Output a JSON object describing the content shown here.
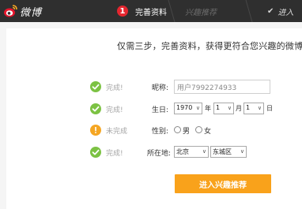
{
  "header": {
    "logo_text": "微博",
    "steps": [
      {
        "number": "1",
        "label": "完善资料"
      },
      {
        "label": "兴趣推荐"
      },
      {
        "label": "进入"
      }
    ]
  },
  "intro_text": "仅需三步，完善资料，获得更符合您兴趣的微博内",
  "form": {
    "nickname": {
      "status": "完成!",
      "label": "昵称:",
      "value": "用户7992274933"
    },
    "birthday": {
      "status": "完成!",
      "label": "生日:",
      "year": "1970",
      "year_unit": "年",
      "month": "1",
      "month_unit": "月",
      "day": "1",
      "day_unit": "日"
    },
    "gender": {
      "status": "未完成",
      "label": "性别:",
      "options": [
        "男",
        "女"
      ]
    },
    "location": {
      "status": "完成!",
      "label": "所在地:",
      "province": "北京",
      "district": "东城区"
    }
  },
  "submit_label": "进入兴趣推荐",
  "colors": {
    "accent_orange": "#f9a21b",
    "ok_green": "#7cc243",
    "warn_orange": "#f5a623",
    "step_red": "#e5262f",
    "header_bg": "#2f2f2f"
  }
}
